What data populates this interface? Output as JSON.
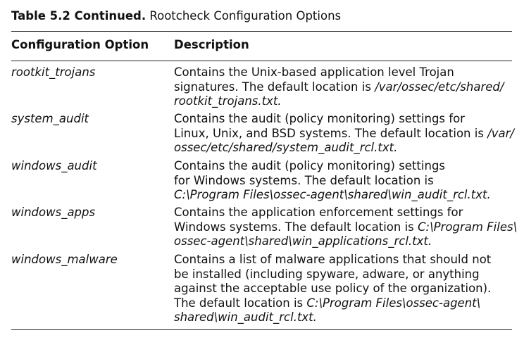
{
  "caption": {
    "label": "Table 5.2 Continued.",
    "title": " Rootcheck Configuration Options"
  },
  "header": {
    "option": "Configuration Option",
    "description": "Description"
  },
  "rows": [
    {
      "option": "rootkit_trojans",
      "lines": [
        [
          {
            "t": "Contains the Unix-based application level Trojan",
            "i": false
          }
        ],
        [
          {
            "t": "signatures. The default location is ",
            "i": false
          },
          {
            "t": "/var/ossec/etc/shared/",
            "i": true
          }
        ],
        [
          {
            "t": "rootkit_trojans.txt.",
            "i": true
          }
        ]
      ]
    },
    {
      "option": "system_audit",
      "lines": [
        [
          {
            "t": "Contains the audit (policy monitoring) settings for",
            "i": false
          }
        ],
        [
          {
            "t": "Linux, Unix, and BSD systems. The default location is ",
            "i": false
          },
          {
            "t": "/var/",
            "i": true
          }
        ],
        [
          {
            "t": "ossec/etc/shared/system_audit_rcl.txt.",
            "i": true
          }
        ]
      ]
    },
    {
      "option": "windows_audit",
      "lines": [
        [
          {
            "t": "Contains the audit (policy monitoring) settings",
            "i": false
          }
        ],
        [
          {
            "t": "for Windows systems. The default location is",
            "i": false
          }
        ],
        [
          {
            "t": "C:\\Program Files\\ossec-agent\\shared\\win_audit_rcl.txt.",
            "i": true
          }
        ]
      ]
    },
    {
      "option": "windows_apps",
      "lines": [
        [
          {
            "t": "Contains the application enforcement settings for",
            "i": false
          }
        ],
        [
          {
            "t": "Windows systems. The default location is ",
            "i": false
          },
          {
            "t": "C:\\Program Files\\",
            "i": true
          }
        ],
        [
          {
            "t": "ossec-agent\\shared\\win_applications_rcl.txt.",
            "i": true
          }
        ]
      ]
    },
    {
      "option": "windows_malware",
      "lines": [
        [
          {
            "t": "Contains a list of malware applications that should not",
            "i": false
          }
        ],
        [
          {
            "t": "be installed (including spyware, adware, or anything",
            "i": false
          }
        ],
        [
          {
            "t": "against the acceptable use policy of the organization).",
            "i": false
          }
        ],
        [
          {
            "t": "The default location is ",
            "i": false
          },
          {
            "t": "C:\\Program Files\\ossec-agent\\",
            "i": true
          }
        ],
        [
          {
            "t": "shared\\win_audit_rcl.txt.",
            "i": true
          }
        ]
      ]
    }
  ]
}
